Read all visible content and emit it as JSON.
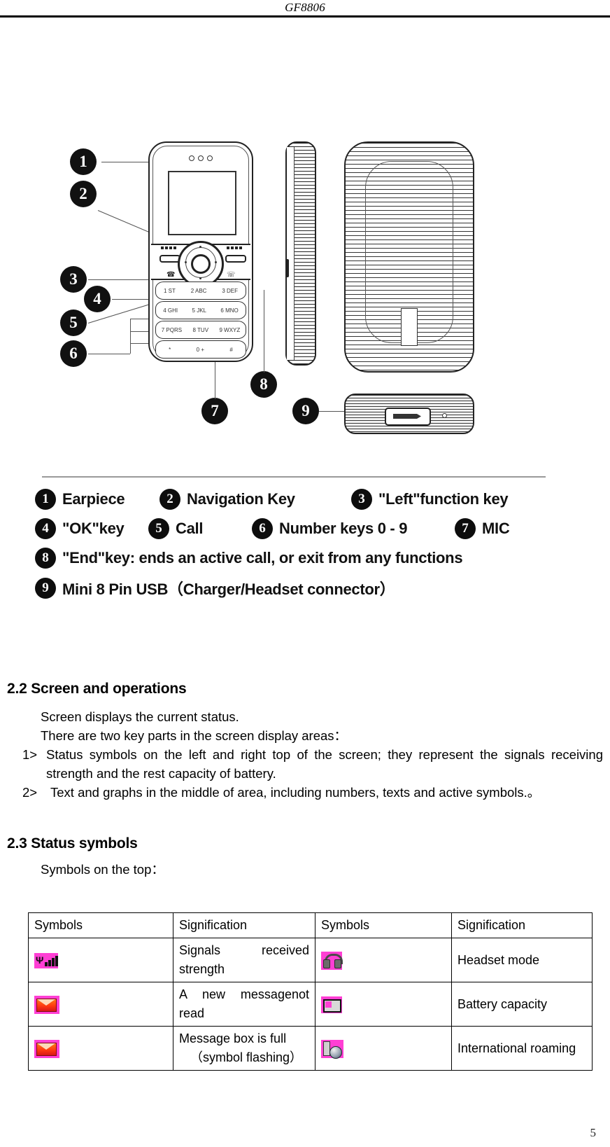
{
  "header": {
    "model_title": "GF8806"
  },
  "figure": {
    "callouts": [
      "1",
      "2",
      "3",
      "4",
      "5",
      "6",
      "7",
      "8",
      "9"
    ],
    "keypad": [
      [
        "1 ST",
        "2 ABC",
        "3 DEF"
      ],
      [
        "4 GHI",
        "5 JKL",
        "6 MNO"
      ],
      [
        "7 PQRS",
        "8 TUV",
        "9 WXYZ"
      ],
      [
        "*",
        "0 +",
        "#"
      ]
    ],
    "legend": [
      {
        "num": "1",
        "label": "Earpiece"
      },
      {
        "num": "2",
        "label": "Navigation Key"
      },
      {
        "num": "3",
        "label": "\"Left\"function key"
      },
      {
        "num": "4",
        "label": "\"OK\"key"
      },
      {
        "num": "5",
        "label": "Call"
      },
      {
        "num": "6",
        "label": "Number keys 0 - 9"
      },
      {
        "num": "7",
        "label": "MIC"
      },
      {
        "num": "8",
        "label": "\"End\"key: ends an active call, or exit from any functions"
      },
      {
        "num": "9",
        "label": "Mini 8 Pin USB（Charger/Headset connector）"
      }
    ]
  },
  "section_22": {
    "heading": "2.2 Screen and operations",
    "line1": "Screen displays the current status.",
    "line2": "There are two key parts in the screen display areas：",
    "item1_num": "1>",
    "item1_text": "Status symbols on the left and right top of the screen; they represent the signals receiving strength and the rest capacity of battery.",
    "item2_num": "2>",
    "item2_text": "Text and graphs in the middle of area, including numbers, texts and active symbols.。"
  },
  "section_23": {
    "heading": "2.3 Status symbols",
    "intro": "Symbols on the top："
  },
  "table": {
    "headers": [
      "Symbols",
      "Signification",
      "Symbols",
      "Signification"
    ],
    "rows": [
      {
        "icon_left": "signal-strength-icon",
        "sig_left_line1": "Signals",
        "sig_left_line2": "received",
        "sig_left_line3": "strength",
        "icon_right": "headset-icon",
        "sig_right": "Headset mode",
        "color": "#000000"
      },
      {
        "icon_left": "new-message-icon",
        "sig_left_line1": "A new message",
        "sig_left_line2": "not",
        "sig_left_line3": "read",
        "icon_right": "battery-icon",
        "sig_right": "Battery capacity",
        "color": "#000000"
      },
      {
        "icon_left": "message-box-full-icon",
        "sig_left_line1": "Message box is full",
        "sig_left_line2": "",
        "sig_left_line3": "（symbol flashing）",
        "icon_right": "international-roaming-icon",
        "sig_right": "International roaming",
        "color": "#ff0000"
      }
    ]
  },
  "footer": {
    "page_number": "5"
  }
}
